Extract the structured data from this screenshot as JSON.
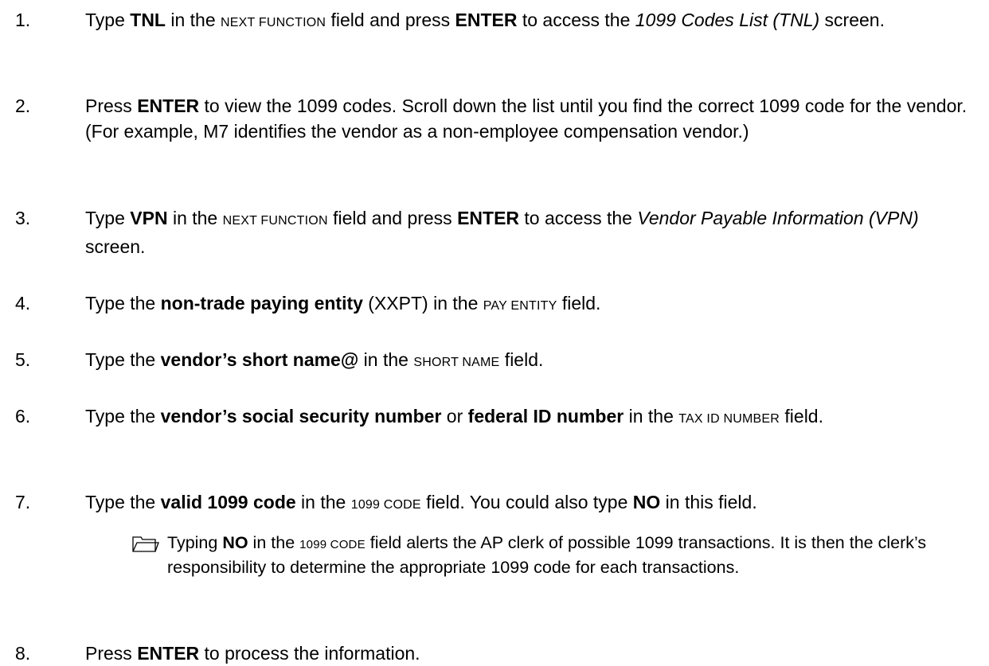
{
  "steps": [
    {
      "num": "1.",
      "parts": [
        {
          "t": "Type "
        },
        {
          "t": "TNL",
          "s": "b"
        },
        {
          "t": " in the "
        },
        {
          "t": "NEXT FUNCTION",
          "s": "sc"
        },
        {
          "t": " field and press "
        },
        {
          "t": "ENTER",
          "s": "b"
        },
        {
          "t": " to access the "
        },
        {
          "t": "1099 Codes List (TNL)",
          "s": "i"
        },
        {
          "t": " screen."
        }
      ]
    },
    {
      "num": "2.",
      "parts": [
        {
          "t": "Press "
        },
        {
          "t": "ENTER",
          "s": "b"
        },
        {
          "t": " to view the 1099 codes. Scroll down the list until you find the correct 1099 code for the vendor. (For example, M7 identifies the vendor as a non-employee compensation vendor.)"
        }
      ]
    },
    {
      "num": "3.",
      "parts": [
        {
          "t": "Type "
        },
        {
          "t": "VPN",
          "s": "b"
        },
        {
          "t": " in the "
        },
        {
          "t": "NEXT FUNCTION",
          "s": "sc"
        },
        {
          "t": " field and press "
        },
        {
          "t": "ENTER",
          "s": "b"
        },
        {
          "t": " to access the "
        },
        {
          "t": "Vendor Payable Information (VPN)",
          "s": "i"
        },
        {
          "t": " screen."
        }
      ]
    },
    {
      "num": "4.",
      "parts": [
        {
          "t": "Type the "
        },
        {
          "t": "non-trade paying entity",
          "s": "b"
        },
        {
          "t": " (XXPT) in the "
        },
        {
          "t": "PAY ENTITY",
          "s": "sc"
        },
        {
          "t": " field."
        }
      ]
    },
    {
      "num": "5.",
      "parts": [
        {
          "t": "Type the "
        },
        {
          "t": "vendor’s short name@",
          "s": "b"
        },
        {
          "t": " in the "
        },
        {
          "t": "SHORT NAME",
          "s": "sc"
        },
        {
          "t": " field."
        }
      ]
    },
    {
      "num": "6.",
      "parts": [
        {
          "t": "Type the "
        },
        {
          "t": "vendor’s social security number",
          "s": "b"
        },
        {
          "t": " or "
        },
        {
          "t": "federal ID number",
          "s": "b"
        },
        {
          "t": " in the "
        },
        {
          "t": "TAX ID NUMBER",
          "s": "sc"
        },
        {
          "t": " field."
        }
      ]
    },
    {
      "num": "7.",
      "parts": [
        {
          "t": "Type the "
        },
        {
          "t": "valid 1099 code",
          "s": "b"
        },
        {
          "t": " in the "
        },
        {
          "t": "1099 CODE",
          "s": "sc"
        },
        {
          "t": " field. You could also type "
        },
        {
          "t": "NO",
          "s": "b"
        },
        {
          "t": " in this field."
        }
      ]
    },
    {
      "num": "8.",
      "parts": [
        {
          "t": "Press "
        },
        {
          "t": "ENTER",
          "s": "b"
        },
        {
          "t": " to process the information."
        }
      ]
    }
  ],
  "note": {
    "icon": "folder-icon",
    "parts": [
      {
        "t": "Typing "
      },
      {
        "t": "NO",
        "s": "b"
      },
      {
        "t": " in the "
      },
      {
        "t": "1099 CODE",
        "s": "sc"
      },
      {
        "t": " field alerts the AP clerk of possible 1099 transactions. It is then the clerk’s responsibility to determine the appropriate 1099 code for each transactions."
      }
    ]
  }
}
